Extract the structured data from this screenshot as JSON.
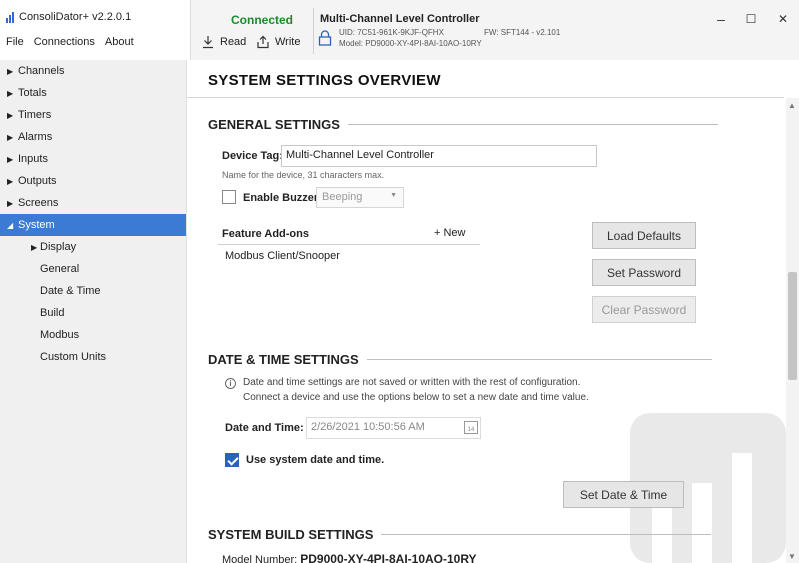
{
  "app": {
    "title": "ConsoliDator+ v2.2.0.1",
    "menu": [
      "File",
      "Connections",
      "About"
    ]
  },
  "toolbar": {
    "status": "Connected",
    "read_label": "Read",
    "write_label": "Write",
    "device_name": "Multi-Channel Level Controller",
    "uid": "UID: 7C51-961K-9KJF-QFHX",
    "model": "Model: PD9000-XY-4PI-8AI-10AO-10RY",
    "fw": "FW: SFT144 - v2.101"
  },
  "window_controls": {
    "minimize": "–",
    "maximize": "☐",
    "close": "✕"
  },
  "sidebar": {
    "items": [
      {
        "label": "Channels",
        "expander": "▶"
      },
      {
        "label": "Totals",
        "expander": "▶"
      },
      {
        "label": "Timers",
        "expander": "▶"
      },
      {
        "label": "Alarms",
        "expander": "▶"
      },
      {
        "label": "Inputs",
        "expander": "▶"
      },
      {
        "label": "Outputs",
        "expander": "▶"
      },
      {
        "label": "Screens",
        "expander": "▶"
      },
      {
        "label": "System",
        "expander": "◢",
        "active": true
      },
      {
        "label": "Display",
        "expander": "▶",
        "sub": true
      },
      {
        "label": "General",
        "sub": true
      },
      {
        "label": "Date & Time",
        "sub": true
      },
      {
        "label": "Build",
        "sub": true
      },
      {
        "label": "Modbus",
        "sub": true
      },
      {
        "label": "Custom Units",
        "sub": true
      }
    ]
  },
  "main": {
    "page_title": "SYSTEM SETTINGS OVERVIEW",
    "general": {
      "heading": "GENERAL SETTINGS",
      "device_tag_label": "Device Tag:",
      "device_tag_value": "Multi-Channel Level Controller",
      "device_tag_hint": "Name for the device, 31 characters max.",
      "buzzer_label": "Enable Buzzer",
      "buzzer_checked": false,
      "buzzer_mode": "Beeping",
      "addons_header": "Feature Add-ons",
      "addons_new": "+ New",
      "addons": [
        "Modbus Client/Snooper"
      ],
      "load_defaults": "Load Defaults",
      "set_password": "Set Password",
      "clear_password": "Clear Password"
    },
    "datetime": {
      "heading": "DATE & TIME SETTINGS",
      "info_line1": "Date and time settings are not saved or written with the rest of configuration.",
      "info_line2": "Connect a device and use the options below to set a new date and time value.",
      "date_label": "Date and Time:",
      "date_value": "2/26/2021 10:50:56 AM",
      "calendar_day": "14",
      "use_system_label": "Use system date and time.",
      "use_system_checked": true,
      "set_button": "Set Date & Time"
    },
    "build": {
      "heading": "SYSTEM BUILD SETTINGS",
      "model_label": "Model Number:",
      "model_value": "PD9000-XY-4PI-8AI-10AO-10RY"
    }
  },
  "colors": {
    "accent": "#3b7bd4",
    "connected": "#1a8a2e",
    "checkbox": "#2b63b8"
  }
}
